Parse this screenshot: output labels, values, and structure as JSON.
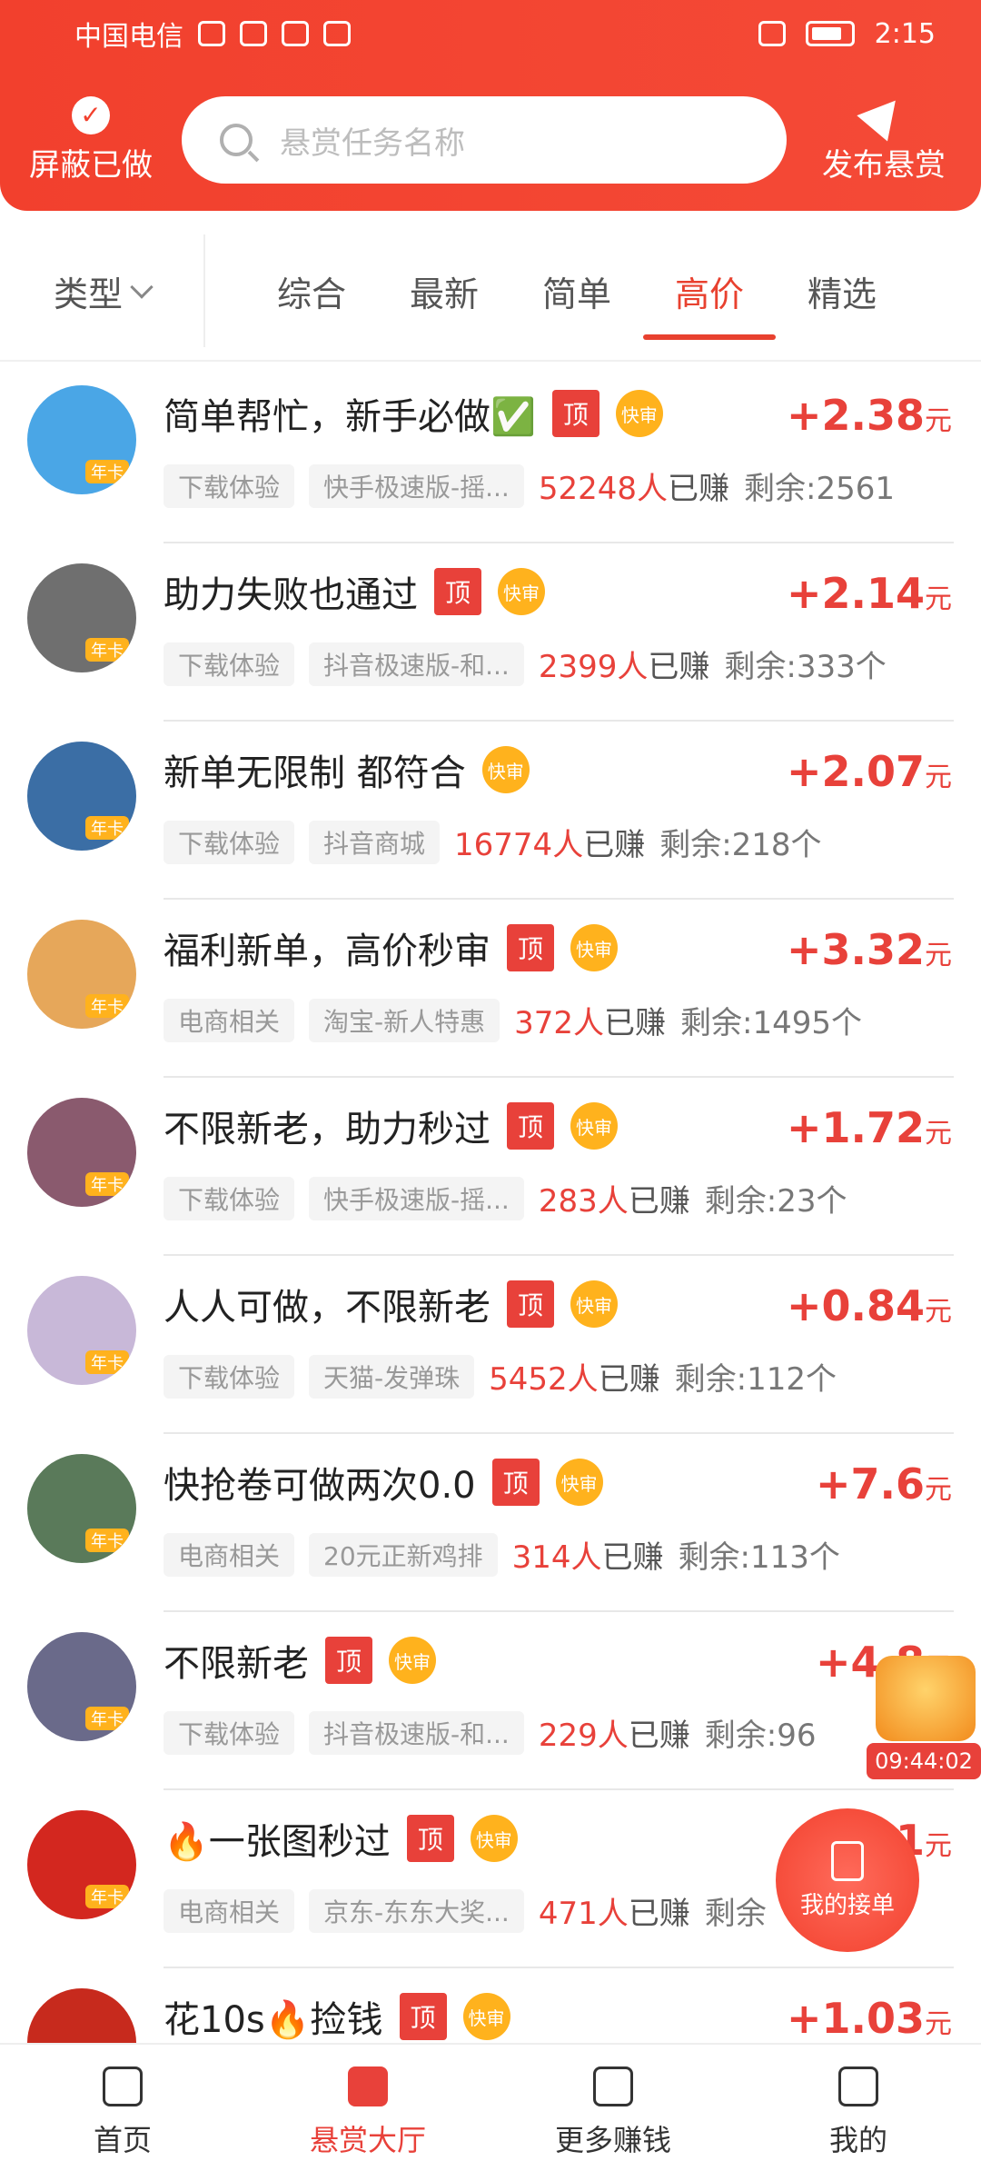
{
  "status": {
    "carrier": "中国电信",
    "time": "2:15"
  },
  "header": {
    "hide_done": "屏蔽已做",
    "search_placeholder": "悬赏任务名称",
    "publish": "发布悬赏"
  },
  "filters": {
    "type_label": "类型",
    "tabs": [
      "综合",
      "最新",
      "简单",
      "高价",
      "精选"
    ],
    "active_tab": "高价"
  },
  "list": [
    {
      "title": "简单帮忙，新手必做✅",
      "top": true,
      "fast": true,
      "price": "+2.38",
      "unit": "元",
      "tag1": "下载体验",
      "tag2": "快手极速版-摇...",
      "earned": "52248人",
      "earned_suffix": "已赚",
      "remain": "剩余:2561",
      "avatar_color": "#4aa6e6"
    },
    {
      "title": "助力失败也通过",
      "top": true,
      "fast": true,
      "price": "+2.14",
      "unit": "元",
      "tag1": "下载体验",
      "tag2": "抖音极速版-和...",
      "earned": "2399人",
      "earned_suffix": "已赚",
      "remain": "剩余:333个",
      "avatar_color": "#6f6f6f"
    },
    {
      "title": "新单无限制 都符合",
      "top": false,
      "fast": true,
      "price": "+2.07",
      "unit": "元",
      "tag1": "下载体验",
      "tag2": "抖音商城",
      "earned": "16774人",
      "earned_suffix": "已赚",
      "remain": "剩余:218个",
      "avatar_color": "#3b6ea5"
    },
    {
      "title": "福利新单，高价秒审",
      "top": true,
      "fast": true,
      "price": "+3.32",
      "unit": "元",
      "tag1": "电商相关",
      "tag2": "淘宝-新人特惠",
      "earned": "372人",
      "earned_suffix": "已赚",
      "remain": "剩余:1495个",
      "avatar_color": "#e6a75a"
    },
    {
      "title": "不限新老，助力秒过",
      "top": true,
      "fast": true,
      "price": "+1.72",
      "unit": "元",
      "tag1": "下载体验",
      "tag2": "快手极速版-摇...",
      "earned": "283人",
      "earned_suffix": "已赚",
      "remain": "剩余:23个",
      "avatar_color": "#8a5a6e"
    },
    {
      "title": "人人可做，不限新老",
      "top": true,
      "fast": true,
      "price": "+0.84",
      "unit": "元",
      "tag1": "下载体验",
      "tag2": "天猫-发弹珠",
      "earned": "5452人",
      "earned_suffix": "已赚",
      "remain": "剩余:112个",
      "avatar_color": "#c8b8d8"
    },
    {
      "title": "快抢卷可做两次0.0",
      "top": true,
      "fast": true,
      "price": "+7.6",
      "unit": "元",
      "tag1": "电商相关",
      "tag2": "20元正新鸡排",
      "earned": "314人",
      "earned_suffix": "已赚",
      "remain": "剩余:113个",
      "avatar_color": "#5a7a5a"
    },
    {
      "title": "不限新老",
      "top": true,
      "fast": true,
      "price": "+4.8",
      "unit": "元",
      "tag1": "下载体验",
      "tag2": "抖音极速版-和...",
      "earned": "229人",
      "earned_suffix": "已赚",
      "remain": "剩余:96",
      "avatar_color": "#6a6a8a"
    },
    {
      "title": "🔥一张图秒过",
      "top": true,
      "fast": true,
      "price": "+11.1",
      "unit": "元",
      "tag1": "电商相关",
      "tag2": "京东-东东大奖...",
      "earned": "471人",
      "earned_suffix": "已赚",
      "remain": "剩余",
      "avatar_color": "#d3271f"
    },
    {
      "title": "花10s🔥捡钱",
      "top": true,
      "fast": true,
      "price": "+1.03",
      "unit": "元",
      "tag1": "",
      "tag2": "",
      "earned": "",
      "earned_suffix": "",
      "remain": "",
      "avatar_color": "#c72a1d"
    }
  ],
  "badges": {
    "top": "顶",
    "fast": "快审",
    "year": "年卡"
  },
  "floating": {
    "timer": "09:44:02",
    "my_orders": "我的接单"
  },
  "nav": [
    "首页",
    "悬赏大厅",
    "更多赚钱",
    "我的"
  ],
  "colors": {
    "accent": "#e8413a",
    "header": "#f2402d",
    "badge": "#ffb21d"
  }
}
